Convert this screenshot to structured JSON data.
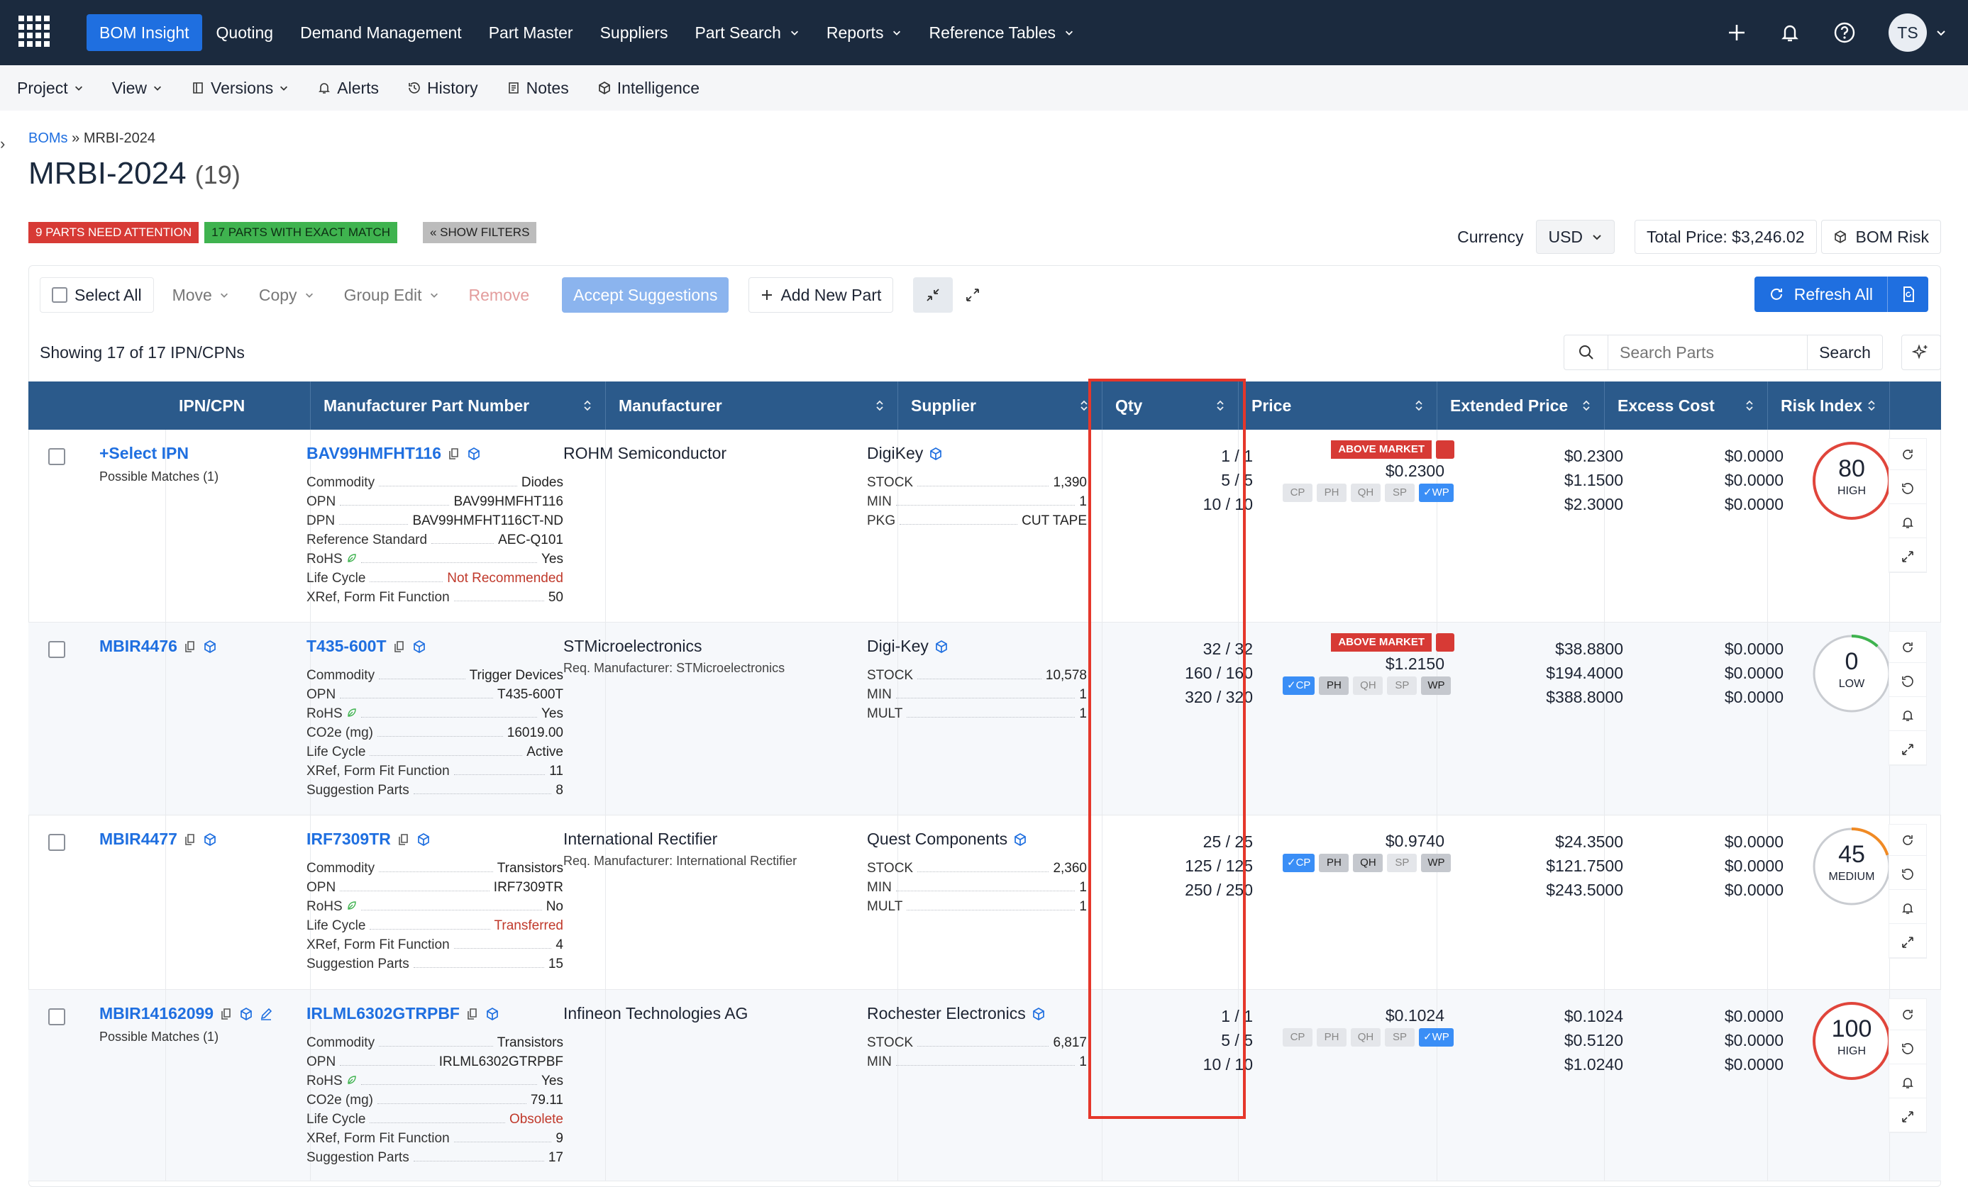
{
  "topbar": {
    "nav": [
      "BOM Insight",
      "Quoting",
      "Demand Management",
      "Part Master",
      "Suppliers",
      "Part Search",
      "Reports",
      "Reference Tables"
    ],
    "nav_dropdown": [
      false,
      false,
      false,
      false,
      false,
      true,
      true,
      true
    ],
    "active_index": 0,
    "avatar": "TS"
  },
  "secondary_nav": [
    "Project",
    "View",
    "Versions",
    "Alerts",
    "History",
    "Notes",
    "Intelligence"
  ],
  "breadcrumb": {
    "root": "BOMs",
    "sep": "»",
    "current": "MRBI-2024"
  },
  "title": {
    "name": "MRBI-2024",
    "count": "(19)"
  },
  "badges": {
    "attention": "9 Parts Need Attention",
    "exact": "17 Parts With Exact Match",
    "filters": "« Show Filters"
  },
  "header_right": {
    "currency_label": "Currency",
    "currency": "USD",
    "total_price": "Total Price: $3,246.02",
    "bom_risk": "BOM Risk"
  },
  "toolbar": {
    "select_all": "Select All",
    "move": "Move",
    "copy": "Copy",
    "group_edit": "Group Edit",
    "remove": "Remove",
    "accept": "Accept Suggestions",
    "add": "Add New Part",
    "refresh": "Refresh All"
  },
  "showing": "Showing 17 of 17 IPN/CPNs",
  "search": {
    "placeholder": "Search Parts",
    "button": "Search"
  },
  "columns": [
    "IPN/CPN",
    "Manufacturer Part Number",
    "Manufacturer",
    "Supplier",
    "Qty",
    "Price",
    "Extended Price",
    "Excess Cost",
    "Risk Index"
  ],
  "rows": [
    {
      "ipn": "+Select IPN",
      "possible": "Possible Matches (1)",
      "mpn": "BAV99HMFHT116",
      "attrs": [
        {
          "k": "Commodity",
          "v": "Diodes"
        },
        {
          "k": "OPN",
          "v": "BAV99HMFHT116"
        },
        {
          "k": "DPN",
          "v": "BAV99HMFHT116CT-ND"
        },
        {
          "k": "Reference Standard",
          "v": "AEC-Q101"
        },
        {
          "k": "RoHS",
          "v": "Yes"
        },
        {
          "k": "Life Cycle",
          "v": "Not Recommended"
        },
        {
          "k": "XRef, Form Fit Function",
          "v": "50"
        }
      ],
      "manufacturer": "ROHM Semiconductor",
      "req_mfr": "",
      "supplier": "DigiKey",
      "sup_attrs": [
        {
          "k": "STOCK",
          "v": "1,390"
        },
        {
          "k": "MIN",
          "v": "1"
        },
        {
          "k": "PKG",
          "v": "CUT TAPE"
        }
      ],
      "qty": [
        "1 / 1",
        "5 / 5",
        "10 / 10"
      ],
      "above_market": "Above Market",
      "price": "$0.2300",
      "chips": [
        "CP",
        "PH",
        "QH",
        "SP",
        "✓WP"
      ],
      "ext": [
        "$0.2300",
        "$1.1500",
        "$2.3000"
      ],
      "excess": [
        "$0.0000",
        "$0.0000",
        "$0.0000"
      ],
      "risk": {
        "value": "80",
        "label": "HIGH"
      }
    },
    {
      "ipn": "MBIR4476",
      "possible": "",
      "mpn": "T435-600T",
      "attrs": [
        {
          "k": "Commodity",
          "v": "Trigger Devices"
        },
        {
          "k": "OPN",
          "v": "T435-600T"
        },
        {
          "k": "RoHS",
          "v": "Yes"
        },
        {
          "k": "CO2e (mg)",
          "v": "16019.00"
        },
        {
          "k": "Life Cycle",
          "v": "Active"
        },
        {
          "k": "XRef, Form Fit Function",
          "v": "11"
        },
        {
          "k": "Suggestion Parts",
          "v": "8"
        }
      ],
      "manufacturer": "STMicroelectronics",
      "req_mfr": "Req. Manufacturer: STMicroelectronics",
      "supplier": "Digi-Key",
      "sup_attrs": [
        {
          "k": "STOCK",
          "v": "10,578"
        },
        {
          "k": "MIN",
          "v": "1"
        },
        {
          "k": "MULT",
          "v": "1"
        }
      ],
      "qty": [
        "32 / 32",
        "160 / 160",
        "320 / 320"
      ],
      "above_market": "Above Market",
      "price": "$1.2150",
      "chips": [
        "✓CP",
        "PH",
        "QH",
        "SP",
        "WP"
      ],
      "ext": [
        "$38.8800",
        "$194.4000",
        "$388.8000"
      ],
      "excess": [
        "$0.0000",
        "$0.0000",
        "$0.0000"
      ],
      "risk": {
        "value": "0",
        "label": "LOW"
      }
    },
    {
      "ipn": "MBIR4477",
      "possible": "",
      "mpn": "IRF7309TR",
      "attrs": [
        {
          "k": "Commodity",
          "v": "Transistors"
        },
        {
          "k": "OPN",
          "v": "IRF7309TR"
        },
        {
          "k": "RoHS",
          "v": "No"
        },
        {
          "k": "Life Cycle",
          "v": "Transferred"
        },
        {
          "k": "XRef, Form Fit Function",
          "v": "4"
        },
        {
          "k": "Suggestion Parts",
          "v": "15"
        }
      ],
      "manufacturer": "International Rectifier",
      "req_mfr": "Req. Manufacturer: International Rectifier",
      "supplier": "Quest Components",
      "sup_attrs": [
        {
          "k": "STOCK",
          "v": "2,360"
        },
        {
          "k": "MIN",
          "v": "1"
        },
        {
          "k": "MULT",
          "v": "1"
        }
      ],
      "qty": [
        "25 / 25",
        "125 / 125",
        "250 / 250"
      ],
      "above_market": "",
      "price": "$0.9740",
      "chips": [
        "✓CP",
        "PH",
        "QH",
        "SP",
        "WP"
      ],
      "ext": [
        "$24.3500",
        "$121.7500",
        "$243.5000"
      ],
      "excess": [
        "$0.0000",
        "$0.0000",
        "$0.0000"
      ],
      "risk": {
        "value": "45",
        "label": "MEDIUM"
      }
    },
    {
      "ipn": "MBIR14162099",
      "possible": "Possible Matches (1)",
      "mpn": "IRLML6302GTRPBF",
      "attrs": [
        {
          "k": "Commodity",
          "v": "Transistors"
        },
        {
          "k": "OPN",
          "v": "IRLML6302GTRPBF"
        },
        {
          "k": "RoHS",
          "v": "Yes"
        },
        {
          "k": "CO2e (mg)",
          "v": "79.11"
        },
        {
          "k": "Life Cycle",
          "v": "Obsolete"
        },
        {
          "k": "XRef, Form Fit Function",
          "v": "9"
        },
        {
          "k": "Suggestion Parts",
          "v": "17"
        }
      ],
      "manufacturer": "Infineon Technologies AG",
      "req_mfr": "",
      "supplier": "Rochester Electronics",
      "sup_attrs": [
        {
          "k": "STOCK",
          "v": "6,817"
        },
        {
          "k": "MIN",
          "v": "1"
        }
      ],
      "qty": [
        "1 / 1",
        "5 / 5",
        "10 / 10"
      ],
      "above_market": "",
      "price": "$0.1024",
      "chips": [
        "CP",
        "PH",
        "QH",
        "SP",
        "✓WP"
      ],
      "ext": [
        "$0.1024",
        "$0.5120",
        "$1.0240"
      ],
      "excess": [
        "$0.0000",
        "$0.0000",
        "$0.0000"
      ],
      "risk": {
        "value": "100",
        "label": "HIGH"
      }
    }
  ],
  "colors": {
    "topbar": "#1b2a3e",
    "accent": "#1f6fe0",
    "header": "#2b5a8b",
    "danger": "#d73a35",
    "success": "#3fb34f",
    "highlight": "#e5372b"
  }
}
